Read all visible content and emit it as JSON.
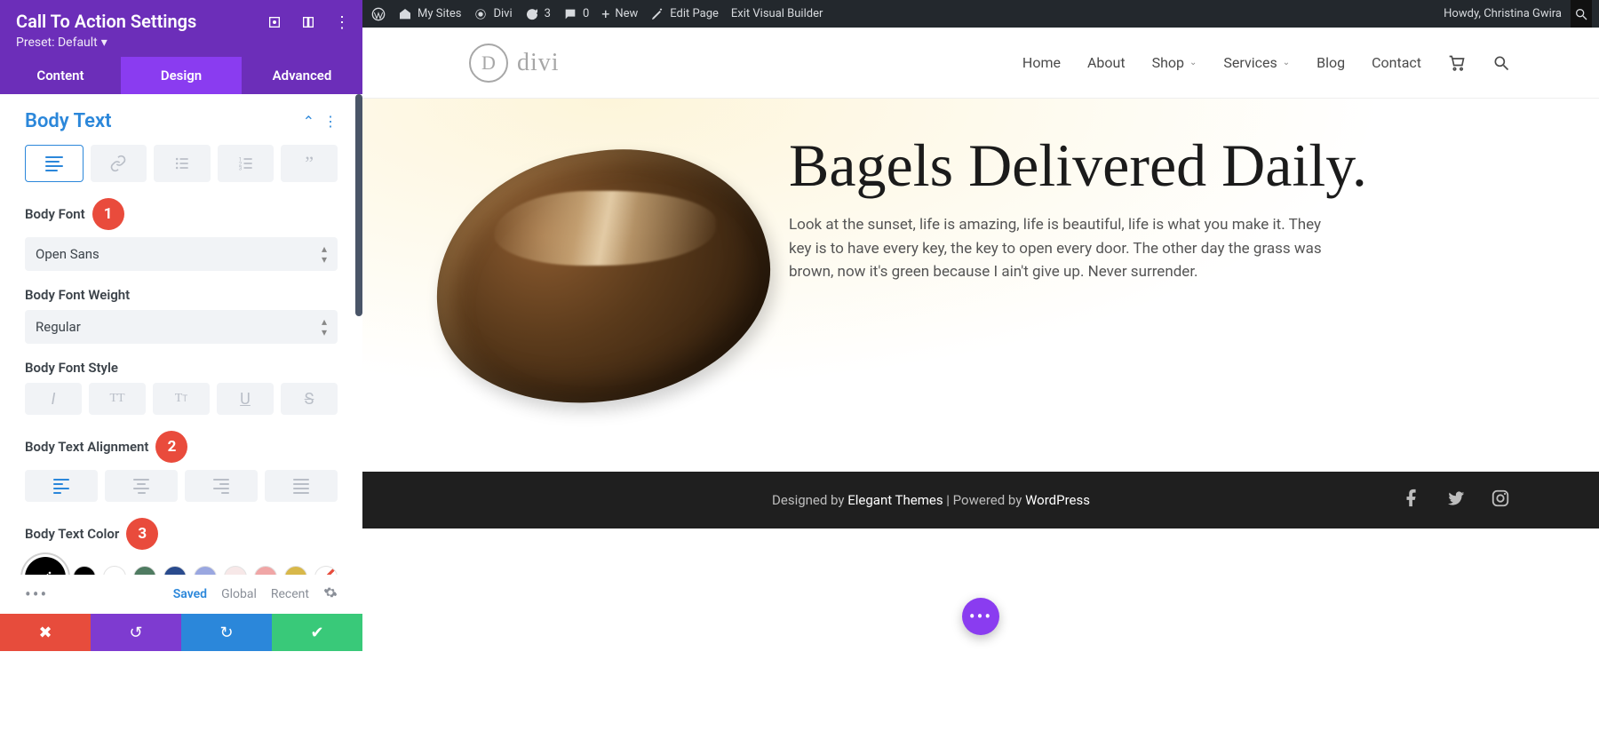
{
  "panel": {
    "title": "Call To Action Settings",
    "preset": "Preset: Default",
    "header_icons": [
      "fullscreen",
      "grid",
      "more"
    ],
    "tabs": {
      "content": "Content",
      "design": "Design",
      "advanced": "Advanced",
      "active": "design"
    },
    "section_title": "Body Text",
    "labels": {
      "body_font": "Body Font",
      "body_font_weight": "Body Font Weight",
      "body_font_style": "Body Font Style",
      "body_text_alignment": "Body Text Alignment",
      "body_text_color": "Body Text Color"
    },
    "body_font_value": "Open Sans",
    "body_font_weight_value": "Regular",
    "markers": {
      "font": "1",
      "alignment": "2",
      "color": "3"
    },
    "palette": [
      "#000000",
      "#ffffff",
      "#4f7b61",
      "#2a4b8d",
      "#9aa7e0",
      "#f7e8e8",
      "#f0a6a6",
      "#d8b84a"
    ],
    "footer_links": {
      "saved": "Saved",
      "global": "Global",
      "recent": "Recent"
    }
  },
  "wp_bar": {
    "my_sites": "My Sites",
    "site_name": "Divi",
    "updates": "3",
    "comments": "0",
    "new": "New",
    "edit_page": "Edit Page",
    "exit_vb": "Exit Visual Builder",
    "howdy": "Howdy, Christina Gwira"
  },
  "site": {
    "logo_letter": "D",
    "logo_text": "divi",
    "nav": {
      "home": "Home",
      "about": "About",
      "shop": "Shop",
      "services": "Services",
      "blog": "Blog",
      "contact": "Contact"
    }
  },
  "hero": {
    "title": "Bagels Delivered Daily.",
    "body": "Look at the sunset, life is amazing, life is beautiful, life is what you make it. They key is to have every key, the key to open every door. The other day the grass was brown, now it's green because I ain't give up. Never surrender."
  },
  "footer": {
    "designed_by_prefix": "Designed by ",
    "designed_by": "Elegant Themes",
    "separator": " | Powered by ",
    "powered_by": "WordPress"
  }
}
